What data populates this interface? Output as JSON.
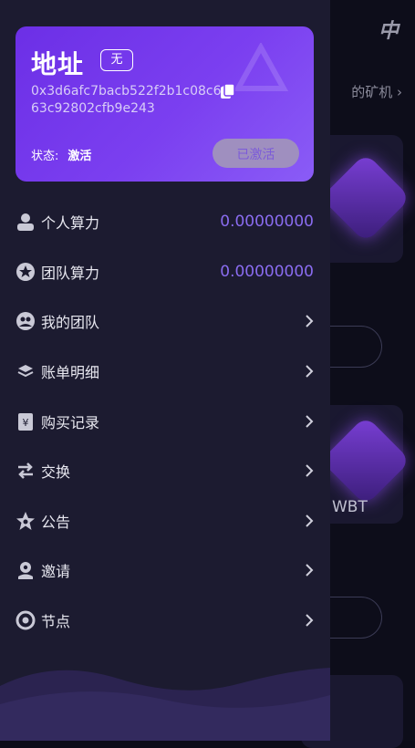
{
  "background": {
    "lang_label": "中",
    "link_text": "的矿机",
    "coin_label": "WBT"
  },
  "card": {
    "title": "地址",
    "badge": "无",
    "address": "0x3d6afc7bacb522f2b1c08c6863c92802cfb9e243",
    "status_label": "状态:",
    "status_value": "激活",
    "button_label": "已激活"
  },
  "menu": [
    {
      "label": "个人算力",
      "value": "0.00000000",
      "icon": "user-icon"
    },
    {
      "label": "团队算力",
      "value": "0.00000000",
      "icon": "team-power-icon"
    },
    {
      "label": "我的团队",
      "icon": "team-icon"
    },
    {
      "label": "账单明细",
      "icon": "bill-icon"
    },
    {
      "label": "购买记录",
      "icon": "purchase-record-icon"
    },
    {
      "label": "交换",
      "icon": "exchange-icon"
    },
    {
      "label": "公告",
      "icon": "announcement-icon"
    },
    {
      "label": "邀请",
      "icon": "invite-icon"
    },
    {
      "label": "节点",
      "icon": "node-icon"
    }
  ],
  "colors": {
    "accent": "#7b3ff0",
    "value_text": "#8a6cf0",
    "drawer_bg": "#1c1b30"
  }
}
